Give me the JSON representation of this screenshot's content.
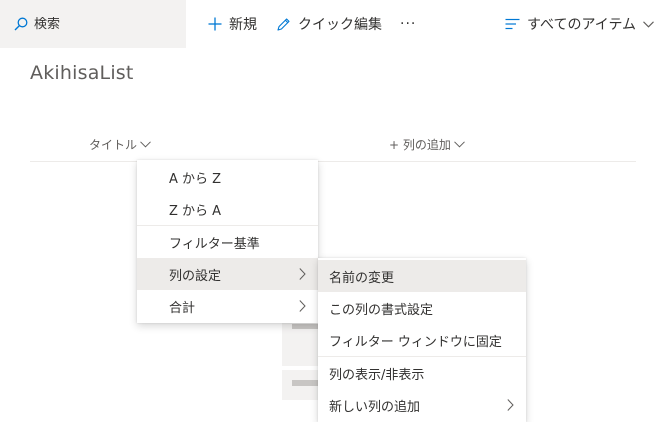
{
  "command_bar": {
    "search_placeholder": "検索",
    "new_label": "新規",
    "quick_edit_label": "クイック編集",
    "more_label": "···",
    "view_label": "すべてのアイテム"
  },
  "list": {
    "title": "AkihisaList"
  },
  "columns": {
    "title_header": "タイトル",
    "add_column": "+ 列の追加"
  },
  "column_menu": {
    "items": [
      "A から Z",
      "Z から A",
      "フィルター基準",
      "列の設定",
      "合計"
    ]
  },
  "column_settings_submenu": {
    "items": [
      "名前の変更",
      "この列の書式設定",
      "フィルター ウィンドウに固定",
      "列の表示/非表示",
      "新しい列の追加"
    ]
  },
  "colors": {
    "accent": "#0078d4",
    "text": "#323130",
    "secondary_text": "#605e5c",
    "hover": "#edebe9"
  }
}
